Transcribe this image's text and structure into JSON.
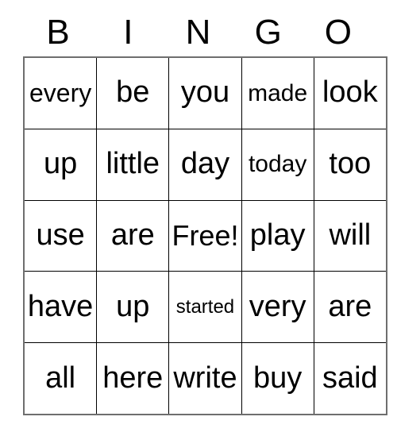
{
  "card": {
    "title": "BINGO",
    "header_letters": [
      "B",
      "I",
      "N",
      "G",
      "O"
    ],
    "free_space_label": "Free!",
    "colors": {
      "background": "#ffffff",
      "text": "#000000",
      "cell_border": "#000000",
      "outer_border": "#6e6e6e"
    },
    "rows": [
      [
        {
          "text": "every",
          "size": "fs-md"
        },
        {
          "text": "be",
          "size": "fs-xl"
        },
        {
          "text": "you",
          "size": "fs-xl"
        },
        {
          "text": "made",
          "size": "fs-sm"
        },
        {
          "text": "look",
          "size": "fs-xl"
        }
      ],
      [
        {
          "text": "up",
          "size": "fs-xl"
        },
        {
          "text": "little",
          "size": "fs-xl"
        },
        {
          "text": "day",
          "size": "fs-xl"
        },
        {
          "text": "today",
          "size": "fs-sm"
        },
        {
          "text": "too",
          "size": "fs-xl"
        }
      ],
      [
        {
          "text": "use",
          "size": "fs-xl"
        },
        {
          "text": "are",
          "size": "fs-xl"
        },
        {
          "text": "Free!",
          "size": "fs-lg"
        },
        {
          "text": "play",
          "size": "fs-xl"
        },
        {
          "text": "will",
          "size": "fs-xl"
        }
      ],
      [
        {
          "text": "have",
          "size": "fs-xl"
        },
        {
          "text": "up",
          "size": "fs-xl"
        },
        {
          "text": "started",
          "size": "fs-xs"
        },
        {
          "text": "very",
          "size": "fs-xl"
        },
        {
          "text": "are",
          "size": "fs-xl"
        }
      ],
      [
        {
          "text": "all",
          "size": "fs-xl"
        },
        {
          "text": "here",
          "size": "fs-xl"
        },
        {
          "text": "write",
          "size": "fs-xl"
        },
        {
          "text": "buy",
          "size": "fs-xl"
        },
        {
          "text": "said",
          "size": "fs-xl"
        }
      ]
    ]
  }
}
